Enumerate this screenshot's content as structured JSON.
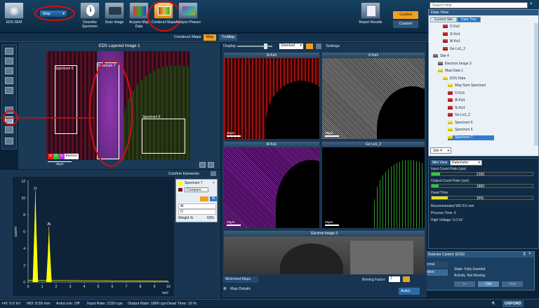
{
  "topbar": {
    "app_label": "EDS-SEM",
    "mode_dropdown": "Map",
    "steps": [
      {
        "label": "Describe Specimen"
      },
      {
        "label": "Scan Image"
      },
      {
        "label": "Acquire Map Data"
      },
      {
        "label": "Construct Maps"
      },
      {
        "label": "Analyze Phases"
      }
    ],
    "report_label": "Report Results",
    "guided_label": "Guided",
    "custom_label": "Custom",
    "search_placeholder": "Search Help"
  },
  "toolbar": {
    "construct_maps_tab": "Construct Maps",
    "map_tab": "Map",
    "trumap_tab": "TruMap"
  },
  "layered_image": {
    "title": "EDS Layered Image 1",
    "spectrum5": "Spectrum 5",
    "spectrum6": "Spectrum 6",
    "spectrum7": "Spectrum 7",
    "legend_si": "Si",
    "legend_o": "O",
    "legend_al": "Al",
    "legend_electron": "Electron",
    "scale": "25µm"
  },
  "display": {
    "label": "Display",
    "mode": "Standard",
    "settings_label": "Settings"
  },
  "maps": [
    {
      "title": "Si Kα1",
      "scale": "25µm"
    },
    {
      "title": "O Kα1",
      "scale": "25µm"
    },
    {
      "title": "Al Kα1",
      "scale": "25µm"
    },
    {
      "title": "Ge Lα1_2",
      "scale": "25µm"
    },
    {
      "title": "Electron Image 3",
      "scale": "25µm"
    }
  ],
  "maps_footer": {
    "minimized_maps": "Minimized Maps",
    "binning_label": "Binning Factor:",
    "binning_value": "1",
    "map_details": "Map Details",
    "autolock": "AutoL"
  },
  "spectrum": {
    "confirm_elements": "Confirm Elements",
    "ylabel": "cps/eV",
    "xlabel": "keV",
    "peak_o": "O",
    "peak_al": "Al",
    "legend_spectrum": "Spectrum 7",
    "legend_compare": "Compare...",
    "table": [
      {
        "el": "Al",
        "val": ""
      },
      {
        "el": "O",
        "val": ""
      }
    ],
    "weight_label": "Weight %",
    "weight_value": "63%",
    "chart_data": {
      "type": "line",
      "xlabel": "keV",
      "ylabel": "cps/eV",
      "x_ticks": [
        0,
        1,
        2,
        3,
        4,
        5,
        6,
        7,
        8,
        9,
        10
      ],
      "y_ticks": [
        0,
        2,
        4,
        6,
        8,
        10,
        12
      ],
      "xlim": [
        0,
        10
      ],
      "ylim": [
        0,
        12
      ],
      "peaks": [
        {
          "label": "O",
          "x": 0.52,
          "y": 10.3
        },
        {
          "label": "Al",
          "x": 1.49,
          "y": 6.1
        }
      ]
    }
  },
  "data_tree": {
    "title": "Data View",
    "tab_current_site": "Current Site",
    "tab_data_tree": "Data Tree",
    "items": [
      {
        "label": "O Kα1",
        "icon": "red",
        "indent": 2
      },
      {
        "label": "Si Kα1",
        "icon": "red",
        "indent": 2
      },
      {
        "label": "Al Kα1",
        "icon": "red",
        "indent": 2
      },
      {
        "label": "Ge Lα1_2",
        "icon": "red",
        "indent": 2
      },
      {
        "label": "Site 4",
        "icon": "site",
        "indent": 0
      },
      {
        "label": "Electron Image 3",
        "icon": "gray",
        "indent": 1
      },
      {
        "label": "Map Data 1",
        "icon": "yellow",
        "indent": 1
      },
      {
        "label": "EDS Data",
        "icon": "yellow",
        "indent": 2
      },
      {
        "label": "Map Sum Spectrum",
        "icon": "yellow",
        "indent": 3
      },
      {
        "label": "O Kα1",
        "icon": "red",
        "indent": 3
      },
      {
        "label": "Al Kα1",
        "icon": "red",
        "indent": 3
      },
      {
        "label": "Si Kα1",
        "icon": "red",
        "indent": 3
      },
      {
        "label": "Ge Lα1_2",
        "icon": "red",
        "indent": 3
      },
      {
        "label": "Spectrum 5",
        "icon": "yellow",
        "indent": 3
      },
      {
        "label": "Spectrum 6",
        "icon": "yellow",
        "indent": 3
      },
      {
        "label": "Spectrum 7",
        "icon": "yellow",
        "indent": 3,
        "selected": true
      }
    ],
    "site_dropdown": "Site 4"
  },
  "mini_view": {
    "tab": "Mini View",
    "mode": "Ratemeter",
    "input_label": "Input Count Rate (cps)",
    "input_value": "2150",
    "input_fraction": 0.08,
    "output_label": "Output Count Rate (cps)",
    "output_value": "1860",
    "output_fraction": 0.07,
    "dead_label": "Dead Time",
    "dead_value": "16%",
    "dead_fraction": 0.16,
    "wd": "Recommended WD 8.5 mm",
    "process_time": "Process Time: 6",
    "high_voltage": "High Voltage: 5.0 kV"
  },
  "detector": {
    "title": "EDS Detector Control: EDS3",
    "thermal": "Thermal",
    "position": "Position",
    "state": "State:   Fully Inserted",
    "activity": "Activity:  Not Moving",
    "btn_in": "In",
    "btn_out": "Out",
    "btn_stop": "Stop"
  },
  "statusbar": {
    "hv": "HV: 5.0 kV",
    "wd": "WD: 8.59 mm",
    "autolock": "AutoLock: Off",
    "input_rate": "Input Rate: 2150 cps",
    "output_rate": "Output Rate: 1860 cps",
    "dead_time": "Dead Time: 16 %",
    "brand": "OXFORD"
  },
  "colors": {
    "accent": "#f0a020",
    "annotation_red": "#d01010",
    "si": "#e02020",
    "o": "#e8e8e8",
    "al": "#c030e0",
    "ge": "#30c030",
    "spectrum_yellow": "#ffff00"
  }
}
